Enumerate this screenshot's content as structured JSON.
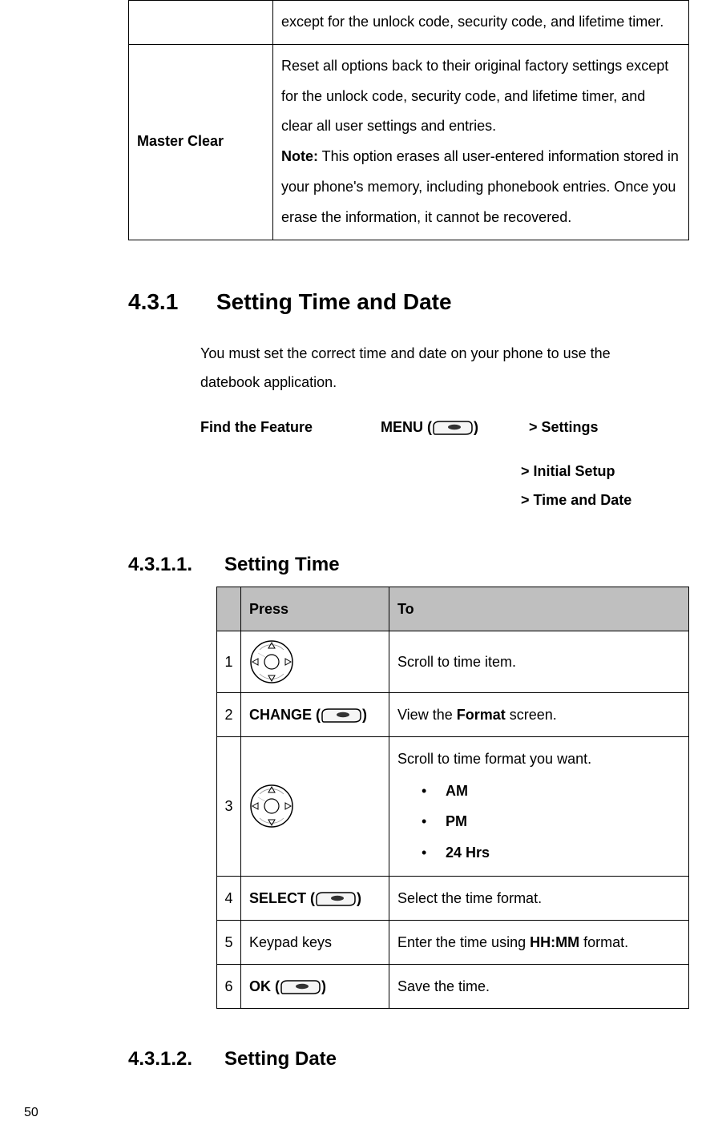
{
  "page_number": "50",
  "top_table": {
    "row1_desc": "except for the unlock code, security code, and lifetime timer.",
    "row2_label": "Master Clear",
    "row2_main": "Reset all options back to their original factory settings except for the unlock code, security code, and lifetime timer, and clear all user settings and entries.",
    "row2_note_label": "Note:",
    "row2_note": " This option erases all user-entered information stored in your phone's memory, including phonebook entries. Once you erase the information, it cannot be recovered."
  },
  "section": {
    "num": "4.3.1",
    "title": "Setting Time and Date",
    "intro": "You must set the correct time and date on your phone to use the datebook application.",
    "find_feature": "Find the Feature",
    "menu_label": "MENU (",
    "menu_close": ")",
    "crumb1": "> Settings",
    "crumb2": "> Initial Setup",
    "crumb3": "> Time and Date"
  },
  "sub1": {
    "num": "4.3.1.1.",
    "title": "Setting Time",
    "headers": {
      "press": "Press",
      "to": "To"
    },
    "rows": [
      {
        "n": "1",
        "press_type": "nav",
        "to_plain": "Scroll to time item."
      },
      {
        "n": "2",
        "press_type": "soft",
        "press_label": "CHANGE (",
        "press_close": ")",
        "to_pre": "View the ",
        "to_bold": "Format",
        "to_post": " screen."
      },
      {
        "n": "3",
        "press_type": "nav",
        "to_pre": "Scroll to time format you want.",
        "bullets": [
          "AM",
          "PM",
          "24 Hrs"
        ]
      },
      {
        "n": "4",
        "press_type": "soft",
        "press_label": "SELECT (",
        "press_close": ")",
        "to_plain": "Select the time format."
      },
      {
        "n": "5",
        "press_type": "text",
        "press_text": "Keypad keys",
        "to_pre": "Enter the time using ",
        "to_bold": "HH:MM",
        "to_post": " format."
      },
      {
        "n": "6",
        "press_type": "soft",
        "press_label": "OK (",
        "press_close": ")",
        "to_plain": "Save the time."
      }
    ]
  },
  "sub2": {
    "num": "4.3.1.2.",
    "title": "Setting Date"
  }
}
